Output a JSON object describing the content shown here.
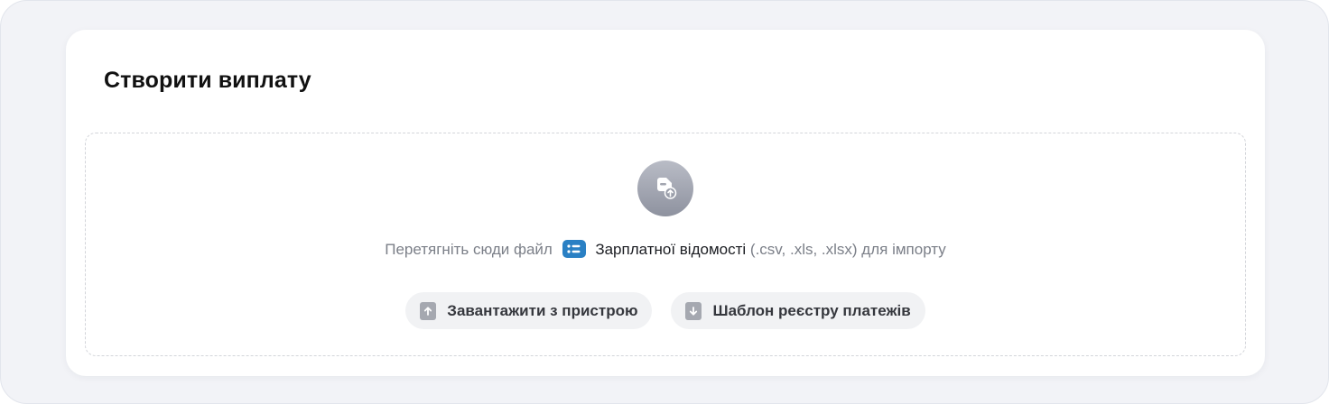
{
  "card": {
    "title": "Створити виплату"
  },
  "dropzone": {
    "text_before": "Перетягніть сюди файл",
    "document_icon": "list-document-icon",
    "document_name": "Зарплатної відомості",
    "text_after": "(.csv, .xls, .xlsx) для імпорту",
    "upload_icon": "file-upload-icon"
  },
  "buttons": {
    "upload_label": "Завантажити з пристрою",
    "upload_icon": "arrow-up-icon",
    "template_label": "Шаблон реєстру платежів",
    "template_icon": "arrow-down-icon"
  },
  "colors": {
    "page_background": "#f2f3f7",
    "card_background": "#ffffff",
    "accent_blue": "#2a80c4",
    "button_background": "#f1f2f4",
    "muted_text": "#7b7f88"
  }
}
